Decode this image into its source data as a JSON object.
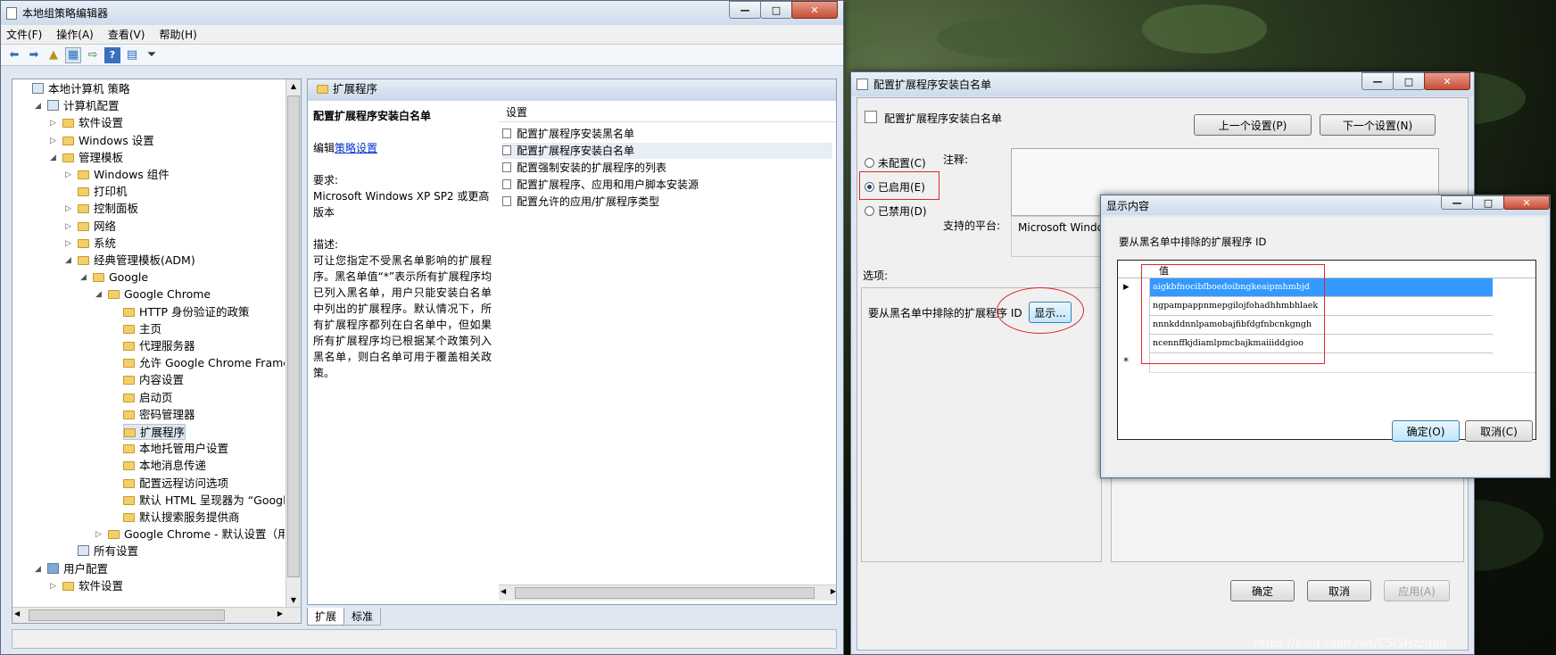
{
  "main_window": {
    "title": "本地组策略编辑器",
    "menu": [
      "文件(F)",
      "操作(A)",
      "查看(V)",
      "帮助(H)"
    ],
    "tree": [
      {
        "label": "本地计算机 策略",
        "level": 0,
        "icon": "computer-policy-icon",
        "expander": ""
      },
      {
        "label": "计算机配置",
        "level": 1,
        "icon": "computer-icon",
        "expander": "open"
      },
      {
        "label": "软件设置",
        "level": 2,
        "icon": "folder-icon",
        "expander": "closed"
      },
      {
        "label": "Windows 设置",
        "level": 2,
        "icon": "folder-icon",
        "expander": "closed"
      },
      {
        "label": "管理模板",
        "level": 2,
        "icon": "folder-icon",
        "expander": "open"
      },
      {
        "label": "Windows 组件",
        "level": 3,
        "icon": "folder-icon",
        "expander": "closed"
      },
      {
        "label": "打印机",
        "level": 3,
        "icon": "folder-icon",
        "expander": ""
      },
      {
        "label": "控制面板",
        "level": 3,
        "icon": "folder-icon",
        "expander": "closed"
      },
      {
        "label": "网络",
        "level": 3,
        "icon": "folder-icon",
        "expander": "closed"
      },
      {
        "label": "系统",
        "level": 3,
        "icon": "folder-icon",
        "expander": "closed"
      },
      {
        "label": "经典管理模板(ADM)",
        "level": 3,
        "icon": "folder-icon",
        "expander": "open"
      },
      {
        "label": "Google",
        "level": 4,
        "icon": "folder-icon",
        "expander": "open"
      },
      {
        "label": "Google Chrome",
        "level": 5,
        "icon": "folder-icon",
        "expander": "open"
      },
      {
        "label": "HTTP 身份验证的政策",
        "level": 6,
        "icon": "folder-icon",
        "expander": ""
      },
      {
        "label": "主页",
        "level": 6,
        "icon": "folder-icon",
        "expander": ""
      },
      {
        "label": "代理服务器",
        "level": 6,
        "icon": "folder-icon",
        "expander": ""
      },
      {
        "label": "允许 Google Chrome Frame处",
        "level": 6,
        "icon": "folder-icon",
        "expander": ""
      },
      {
        "label": "内容设置",
        "level": 6,
        "icon": "folder-icon",
        "expander": ""
      },
      {
        "label": "启动页",
        "level": 6,
        "icon": "folder-icon",
        "expander": ""
      },
      {
        "label": "密码管理器",
        "level": 6,
        "icon": "folder-icon",
        "expander": ""
      },
      {
        "label": "扩展程序",
        "level": 6,
        "icon": "folder-icon",
        "expander": "",
        "selected": true
      },
      {
        "label": "本地托管用户设置",
        "level": 6,
        "icon": "folder-icon",
        "expander": ""
      },
      {
        "label": "本地消息传递",
        "level": 6,
        "icon": "folder-icon",
        "expander": ""
      },
      {
        "label": "配置远程访问选项",
        "level": 6,
        "icon": "folder-icon",
        "expander": ""
      },
      {
        "label": "默认 HTML 呈现器为 “Google",
        "level": 6,
        "icon": "folder-icon",
        "expander": ""
      },
      {
        "label": "默认搜索服务提供商",
        "level": 6,
        "icon": "folder-icon",
        "expander": ""
      },
      {
        "label": "Google Chrome - 默认设置（用户",
        "level": 5,
        "icon": "folder-icon",
        "expander": "closed"
      },
      {
        "label": "所有设置",
        "level": 3,
        "icon": "settings-list-icon",
        "expander": ""
      },
      {
        "label": "用户配置",
        "level": 1,
        "icon": "user-icon",
        "expander": "open"
      },
      {
        "label": "软件设置",
        "level": 2,
        "icon": "folder-icon",
        "expander": "closed"
      }
    ],
    "content_header": "扩展程序",
    "desc_title": "配置扩展程序安装白名单",
    "desc_edit_prefix": "编辑",
    "desc_edit_link": "策略设置",
    "desc_req_label": "要求:",
    "desc_req_text": "Microsoft Windows XP SP2 或更高版本",
    "desc_label": "描述:",
    "desc_text": "可让您指定不受黑名单影响的扩展程序。黑名单值“*”表示所有扩展程序均已列入黑名单，用户只能安装白名单中列出的扩展程序。默认情况下，所有扩展程序都列在白名单中，但如果所有扩展程序均已根据某个政策列入黑名单，则白名单可用于覆盖相关政策。",
    "settings_header": "设置",
    "settings": [
      "配置扩展程序安装黑名单",
      "配置扩展程序安装白名单",
      "配置强制安装的扩展程序的列表",
      "配置扩展程序、应用和用户脚本安装源",
      "配置允许的应用/扩展程序类型"
    ],
    "tabs": [
      "扩展",
      "标准"
    ]
  },
  "config_dialog": {
    "title": "配置扩展程序安装白名单",
    "heading": "配置扩展程序安装白名单",
    "prev_button": "上一个设置(P)",
    "next_button": "下一个设置(N)",
    "radio_not_configured": "未配置(C)",
    "radio_enabled": "已启用(E)",
    "radio_disabled": "已禁用(D)",
    "comment_label": "注释:",
    "platform_label": "支持的平台:",
    "platform_value": "Microsoft Windo",
    "options_label": "选项:",
    "option_text": "要从黑名单中排除的扩展程序 ID",
    "show_button": "显示...",
    "ok_button": "确定",
    "cancel_button": "取消",
    "apply_button": "应用(A)"
  },
  "show_dialog": {
    "title": "显示内容",
    "label": "要从黑名单中排除的扩展程序 ID",
    "column_header": "值",
    "rows": [
      "aigkbfnocibfboedoibngkeaipmhmbjd",
      "ngpampappnmepgilojfohadhhmbhlaek",
      "nnnkddnnlpamobajfibfdgfnbcnkgngh",
      "ncennffkjdiamlpmcbajkmaiiiddgioo"
    ],
    "new_row_marker": "*",
    "current_row_marker": "▸",
    "ok_button": "确定(O)",
    "cancel_button": "取消(C)"
  },
  "watermark": "https://blog.csdn.net/CSISHzzggg",
  "colors": {
    "highlight": "#3399ff",
    "red_box": "#e0262a",
    "link": "#0033cc"
  }
}
